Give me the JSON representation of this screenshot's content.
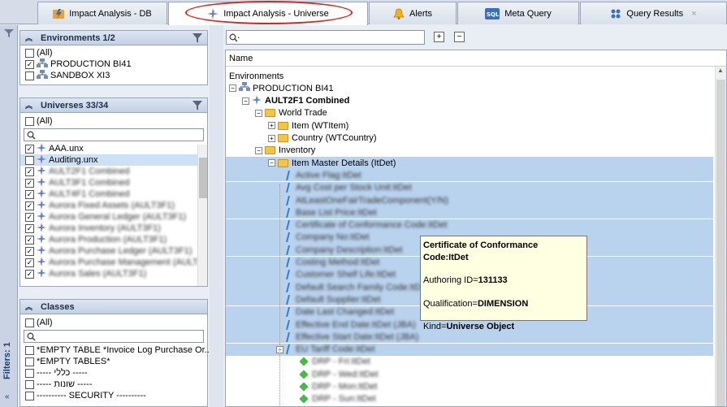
{
  "tabs": [
    {
      "label": "Impact Analysis - DB",
      "icon": "impact-db-icon"
    },
    {
      "label": "Impact Analysis - Universe",
      "icon": "impact-universe-icon",
      "active": true
    },
    {
      "label": "Alerts",
      "icon": "bell-icon"
    },
    {
      "label": "Meta Query",
      "icon": "sql-icon"
    },
    {
      "label": "Query Results",
      "icon": "query-results-icon",
      "close": "×"
    }
  ],
  "filters_label": "Filters: 1",
  "environments": {
    "title": "Environments 1/2",
    "items": [
      {
        "label": "(All)",
        "checked": false
      },
      {
        "label": "PRODUCTION BI41",
        "checked": true
      },
      {
        "label": "SANDBOX XI3",
        "checked": false
      }
    ]
  },
  "universes": {
    "title": "Universes 33/34",
    "all_label": "(All)",
    "items": [
      {
        "label": "AAA.unx",
        "checked": true,
        "blur": false
      },
      {
        "label": "Auditing.unx",
        "checked": false,
        "blur": false,
        "selected": true
      },
      {
        "label": "AULT2F1 Combined",
        "checked": true,
        "blur": true
      },
      {
        "label": "AULT3F1 Combined",
        "checked": true,
        "blur": true
      },
      {
        "label": "AULT4F1 Combined",
        "checked": true,
        "blur": true
      },
      {
        "label": "Aurora Fixed Assets (AULT3F1)",
        "checked": true,
        "blur": true
      },
      {
        "label": "Aurora General Ledger (AULT3F1)",
        "checked": true,
        "blur": true
      },
      {
        "label": "Aurora Inventory (AULT3F1)",
        "checked": true,
        "blur": true
      },
      {
        "label": "Aurora Production (AULT3F1)",
        "checked": true,
        "blur": true
      },
      {
        "label": "Aurora Purchase Ledger (AULT3F1)",
        "checked": true,
        "blur": true
      },
      {
        "label": "Aurora Purchase Management (AULT...",
        "checked": true,
        "blur": true
      },
      {
        "label": "Aurora Sales (AULT3F1)",
        "checked": true,
        "blur": true
      }
    ]
  },
  "classes": {
    "title": "Classes",
    "all_label": "(All)",
    "items": [
      "*EMPTY TABLE *Invoice Log Purchase Or...",
      "*EMPTY TABLES*",
      "----- כללי -----",
      "----- שונות -----",
      "---------- SECURITY ----------"
    ]
  },
  "tree": {
    "column_header": "Name",
    "rows": [
      {
        "label": "Environments",
        "indent": 0,
        "type": "text"
      },
      {
        "label": "PRODUCTION BI41",
        "indent": 1,
        "type": "env",
        "tog": "−"
      },
      {
        "label": "AULT2F1 Combined",
        "indent": 2,
        "type": "universe",
        "tog": "−",
        "bold": true
      },
      {
        "label": "World Trade",
        "indent": 3,
        "type": "folder",
        "tog": "−"
      },
      {
        "label": "Item (WTItem)",
        "indent": 4,
        "type": "folder",
        "tog": "+"
      },
      {
        "label": "Country (WTCountry)",
        "indent": 4,
        "type": "folder",
        "tog": "+"
      },
      {
        "label": "Inventory",
        "indent": 3,
        "type": "folder",
        "tog": "−"
      },
      {
        "label": "Item Master Details (ItDet)",
        "indent": 4,
        "type": "folder",
        "tog": "−",
        "hl": true
      },
      {
        "label": "Active Flag:ItDet",
        "indent": 5,
        "type": "obj",
        "hl": true,
        "blur": true
      },
      {
        "label": "Avg Cost per Stock Unit:ItDet",
        "indent": 5,
        "type": "obj",
        "hl": true,
        "blur": true
      },
      {
        "label": "AtLeastOneFairTradeComponent(Y/N)",
        "indent": 5,
        "type": "obj",
        "hl": true,
        "blur": true
      },
      {
        "label": "Base List Price:ItDet",
        "indent": 5,
        "type": "obj",
        "hl": true,
        "blur": true
      },
      {
        "label": "Certificate of Conformance Code:ItDet",
        "indent": 5,
        "type": "obj",
        "hl": true,
        "blur": true
      },
      {
        "label": "Company No:ItDet",
        "indent": 5,
        "type": "obj",
        "hl": true,
        "blur": true
      },
      {
        "label": "Company Description:ItDet",
        "indent": 5,
        "type": "obj",
        "hl": true,
        "blur": true
      },
      {
        "label": "Costing Method:ItDet",
        "indent": 5,
        "type": "obj",
        "hl": true,
        "blur": true
      },
      {
        "label": "Customer Shelf Life:ItDet",
        "indent": 5,
        "type": "obj",
        "hl": true,
        "blur": true
      },
      {
        "label": "Default Search Family Code:ItDet",
        "indent": 5,
        "type": "obj",
        "hl": true,
        "blur": true
      },
      {
        "label": "Default Supplier:ItDet",
        "indent": 5,
        "type": "obj",
        "hl": true,
        "blur": true
      },
      {
        "label": "Date Last Changed:ItDet",
        "indent": 5,
        "type": "obj",
        "hl": true,
        "blur": true
      },
      {
        "label": "Effective End Date:ItDet (JBA)",
        "indent": 5,
        "type": "obj",
        "hl": true,
        "blur": true
      },
      {
        "label": "Effective Start Date:ItDet (JBA)",
        "indent": 5,
        "type": "obj",
        "hl": true,
        "blur": true
      },
      {
        "label": "EU Tariff Code:ItDet",
        "indent": 5,
        "type": "obj",
        "tog": "−",
        "hl": true,
        "blur": true
      },
      {
        "label": "DRP - Fri:ItDet",
        "indent": 6,
        "type": "green",
        "blur": true
      },
      {
        "label": "DRP - Wed:ItDet",
        "indent": 6,
        "type": "green",
        "blur": true
      },
      {
        "label": "DRP - Mon:ItDet",
        "indent": 6,
        "type": "green",
        "blur": true
      },
      {
        "label": "DRP - Sun:ItDet",
        "indent": 6,
        "type": "green",
        "blur": true
      },
      {
        "label": "DRP - Sat:ItDet",
        "indent": 6,
        "type": "green",
        "blur": true
      }
    ]
  },
  "tooltip": {
    "title": "Certificate of Conformance Code:ItDet",
    "authoring_label": "Authoring ID=",
    "authoring_value": "131133",
    "qualification_label": "Qualification=",
    "qualification_value": "DIMENSION",
    "kind_label": "Kind=",
    "kind_value": "Universe Object"
  }
}
